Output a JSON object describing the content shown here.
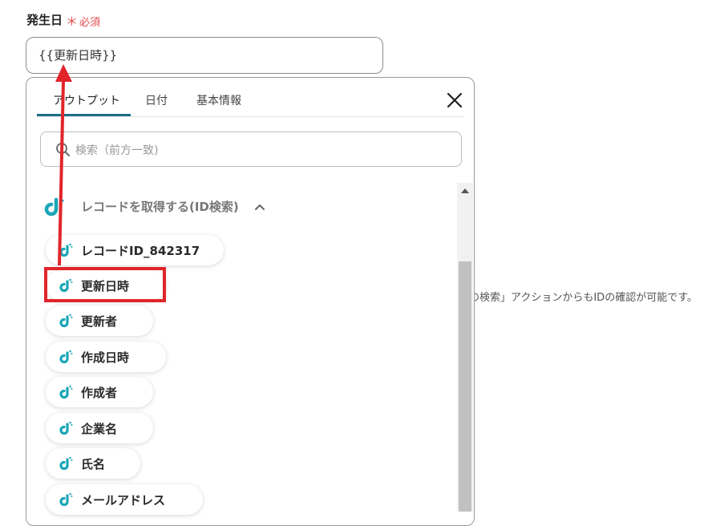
{
  "field": {
    "label": "発生日",
    "required_star": "＊",
    "required_text": "必須",
    "value": "{{更新日時}}"
  },
  "side_hint": "の検索」アクションからもIDの確認が可能です。",
  "popup": {
    "tabs": [
      {
        "label": "アウトプット",
        "active": true
      },
      {
        "label": "日付",
        "active": false
      },
      {
        "label": "基本情報",
        "active": false
      }
    ],
    "close_icon": "close-icon",
    "search": {
      "placeholder": "検索（前方一致)"
    },
    "group": {
      "title": "レコードを取得する(ID検索)",
      "expanded": true
    },
    "items": [
      {
        "label": "レコードID_842317"
      },
      {
        "label": "更新日時",
        "highlighted": true
      },
      {
        "label": "更新者"
      },
      {
        "label": "作成日時"
      },
      {
        "label": "作成者"
      },
      {
        "label": "企業名"
      },
      {
        "label": "氏名"
      },
      {
        "label": "メールアドレス"
      }
    ]
  },
  "colors": {
    "accent": "#1b6f87",
    "required": "#e5484d",
    "annotation": "#e1252a",
    "logo": "#1aa6b7"
  }
}
